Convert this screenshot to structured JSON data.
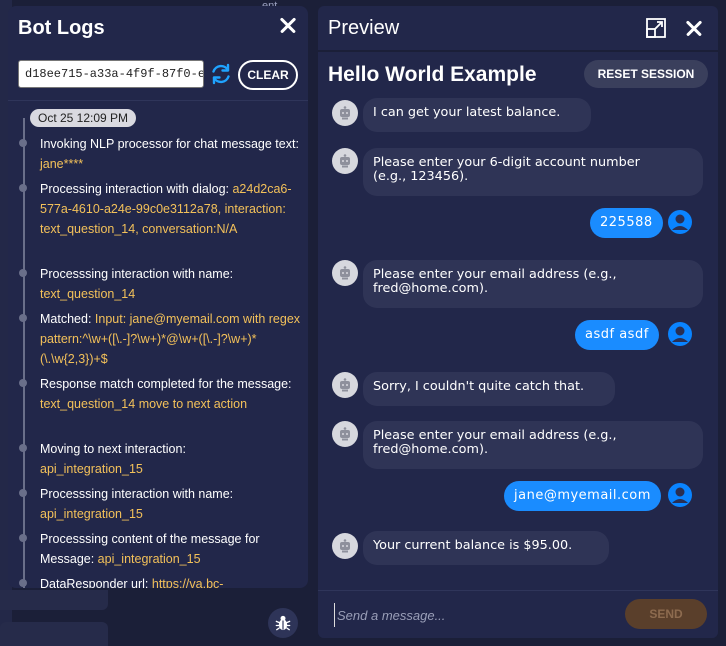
{
  "background": {
    "top_label": "ent"
  },
  "logs": {
    "title": "Bot Logs",
    "session_id": "d18ee715-a33a-4f9f-87f0-eb7",
    "clear_label": "CLEAR",
    "timestamp": "Oct 25 12:09 PM",
    "entries": [
      {
        "text": "Invoking NLP processor for chat message text: ",
        "hl": "jane****"
      },
      {
        "text": "Processing interaction with dialog: ",
        "hl": "a24d2ca6-577a-4610-a24e-99c0e3112a78, interaction: text_question_14, conversation:N/A"
      },
      {
        "text": "Processsing interaction with name: ",
        "hl": "text_question_14"
      },
      {
        "text": "Matched: ",
        "hl": "Input: jane@myemail.com with regex pattern:^\\w+([\\.-]?\\w+)*@\\w+([\\.-]?\\w+)*(\\.\\w{2,3})+$"
      },
      {
        "text": "Response match completed for the message: ",
        "hl": "text_question_14 move to next action"
      },
      {
        "text": "Moving to next interaction: ",
        "hl": "api_integration_15"
      },
      {
        "text": "Processsing interaction with name: ",
        "hl": "api_integration_15"
      },
      {
        "text": "Processsing content of the message for Message: ",
        "hl": "api_integration_15"
      },
      {
        "text": "DataResponder url: ",
        "hl": "https://va.bc-"
      }
    ]
  },
  "preview": {
    "title": "Preview",
    "bot_name": "Hello World Example",
    "reset_label": "RESET SESSION",
    "messages": [
      {
        "from": "bot",
        "text": "I can get your latest balance."
      },
      {
        "from": "bot",
        "text": "Please enter your 6-digit account number\n(e.g., 123456)."
      },
      {
        "from": "user",
        "text": "225588"
      },
      {
        "from": "bot",
        "text": "Please enter your email address (e.g.,\nfred@home.com)."
      },
      {
        "from": "user",
        "text": "asdf asdf"
      },
      {
        "from": "bot",
        "text": "Sorry, I couldn't quite catch that."
      },
      {
        "from": "bot",
        "text": "Please enter your email address (e.g.,\nfred@home.com)."
      },
      {
        "from": "user",
        "text": "jane@myemail.com"
      },
      {
        "from": "bot",
        "text": "Your current balance is $95.00."
      }
    ],
    "input_placeholder": "Send a message...",
    "send_label": "SEND"
  },
  "colors": {
    "background": "#1b1f38",
    "panel": "#22274a",
    "highlight": "#f3c15a",
    "user_bubble": "#1a8cff",
    "bot_bubble": "#2f3456",
    "send_disabled": "#5a3f2b"
  },
  "icons": [
    "close-icon",
    "refresh-icon",
    "expand-icon",
    "bot-avatar-icon",
    "user-avatar-icon",
    "bug-icon"
  ]
}
